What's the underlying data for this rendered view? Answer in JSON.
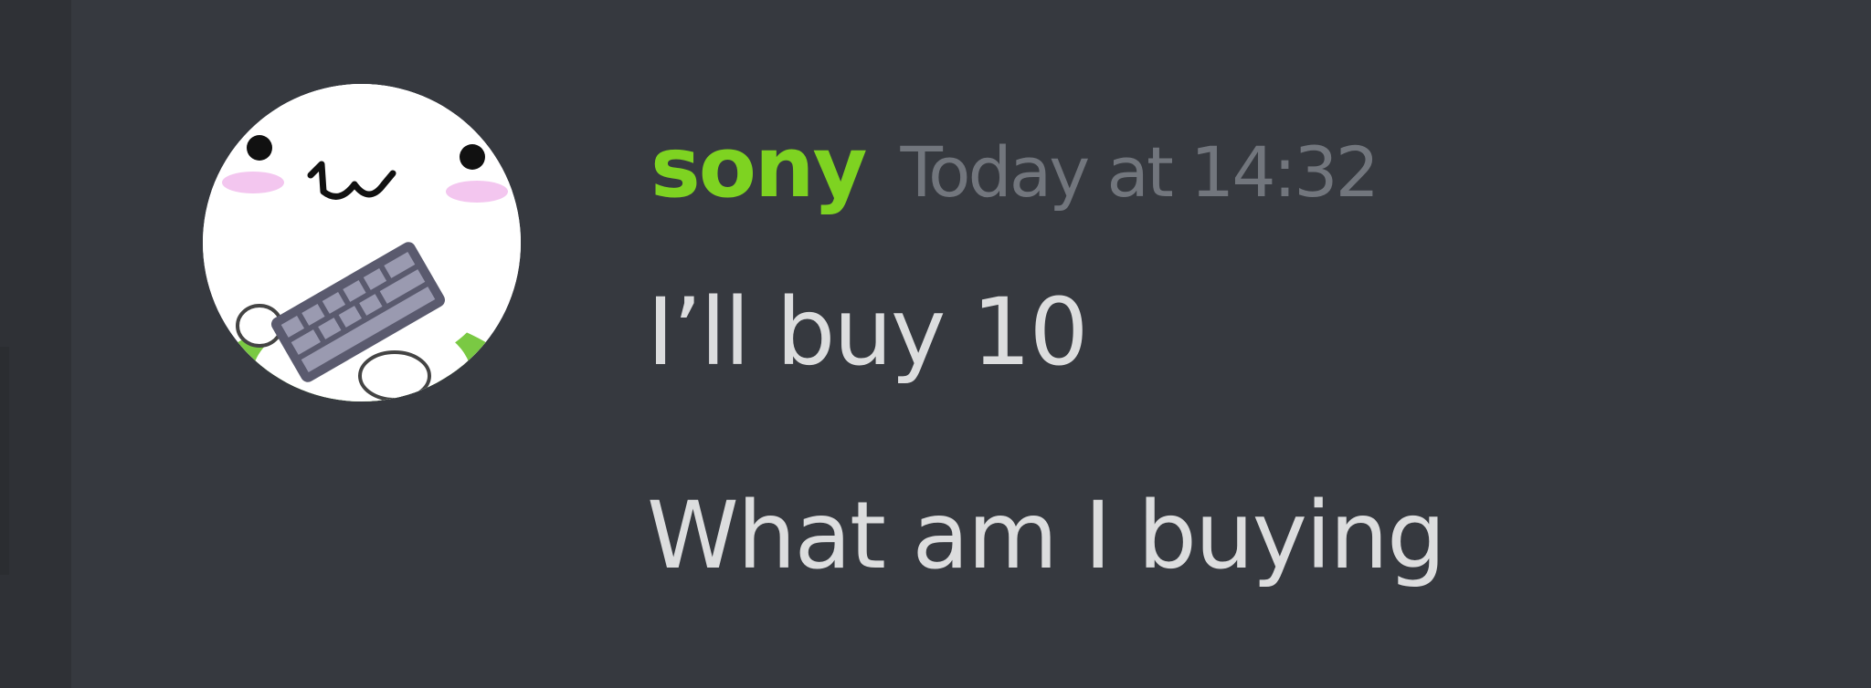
{
  "message": {
    "author": {
      "username": "sony",
      "name_color": "#7ed321",
      "avatar_icon": "cat-holding-keyboard-avatar"
    },
    "timestamp": "Today at 14:32",
    "lines": [
      "I’ll buy 10",
      "What am I buying"
    ]
  },
  "theme": {
    "background": "#36393f",
    "text": "#dcddde",
    "muted": "#72767d"
  }
}
